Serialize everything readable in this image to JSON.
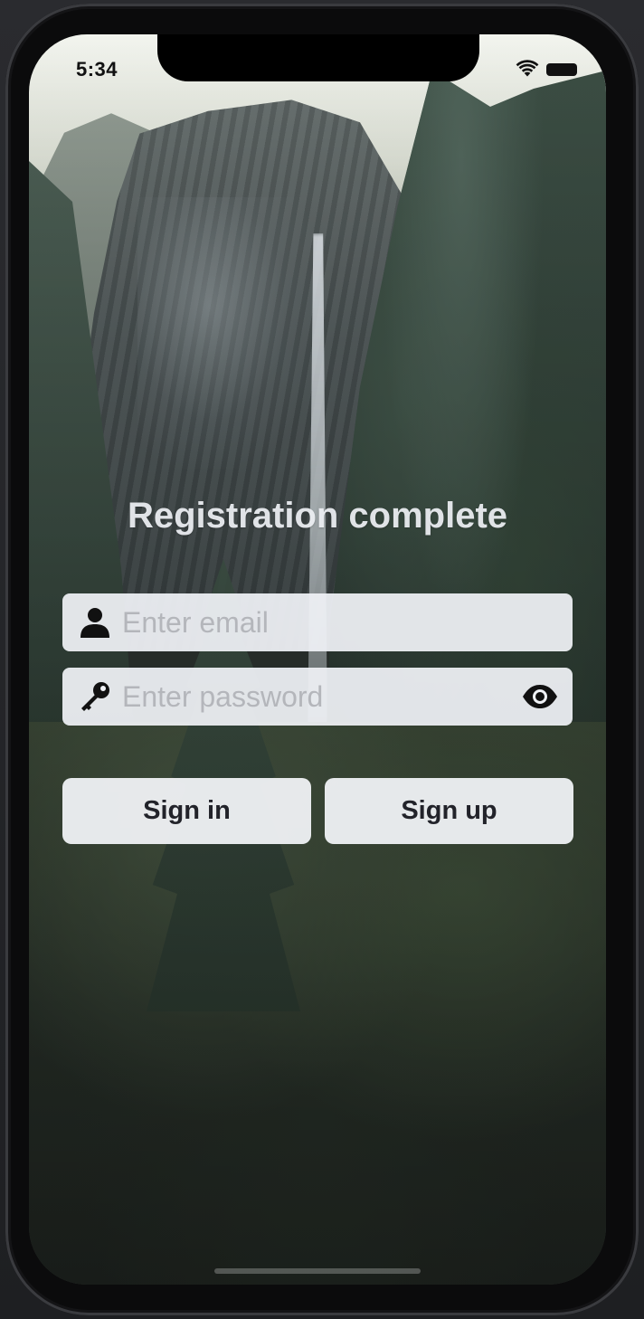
{
  "status_bar": {
    "time": "5:34",
    "wifi_icon": "wifi-icon",
    "battery_icon": "battery-icon"
  },
  "screen": {
    "title": "Registration complete"
  },
  "form": {
    "email": {
      "placeholder": "Enter email",
      "value": "",
      "icon": "person-icon"
    },
    "password": {
      "placeholder": "Enter password",
      "value": "",
      "icon": "key-icon",
      "toggle_icon": "eye-icon"
    }
  },
  "buttons": {
    "sign_in_label": "Sign in",
    "sign_up_label": "Sign up"
  },
  "colors": {
    "field_background": "#F0F2F6",
    "button_text": "#22232A",
    "placeholder_text": "#B4B6BB",
    "title_text": "#F0F2F6"
  }
}
